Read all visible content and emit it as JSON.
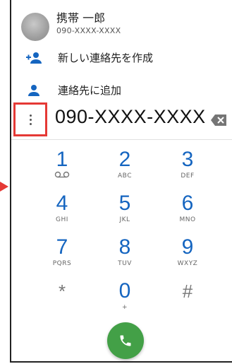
{
  "contact": {
    "name": "携帯 一郎",
    "number": "090-XXXX-XXXX"
  },
  "actions": {
    "create_new": "新しい連絡先を作成",
    "add_to_contact": "連絡先に追加"
  },
  "dialer": {
    "entered_number": "090-XXXX-XXXX",
    "keys": [
      {
        "num": "1",
        "letters": "voicemail"
      },
      {
        "num": "2",
        "letters": "ABC"
      },
      {
        "num": "3",
        "letters": "DEF"
      },
      {
        "num": "4",
        "letters": "GHI"
      },
      {
        "num": "5",
        "letters": "JKL"
      },
      {
        "num": "6",
        "letters": "MNO"
      },
      {
        "num": "7",
        "letters": "PQRS"
      },
      {
        "num": "8",
        "letters": "TUV"
      },
      {
        "num": "9",
        "letters": "WXYZ"
      },
      {
        "num": "*",
        "letters": ""
      },
      {
        "num": "0",
        "letters": "+"
      },
      {
        "num": "#",
        "letters": ""
      }
    ]
  },
  "colors": {
    "accent": "#1565c0",
    "call": "#43a047",
    "highlight": "#e53935"
  },
  "icons": {
    "menu": "more-vert-icon",
    "backspace": "backspace-icon",
    "call": "phone-icon",
    "add_person": "person-add-icon",
    "person": "person-icon",
    "voicemail": "voicemail-icon"
  }
}
